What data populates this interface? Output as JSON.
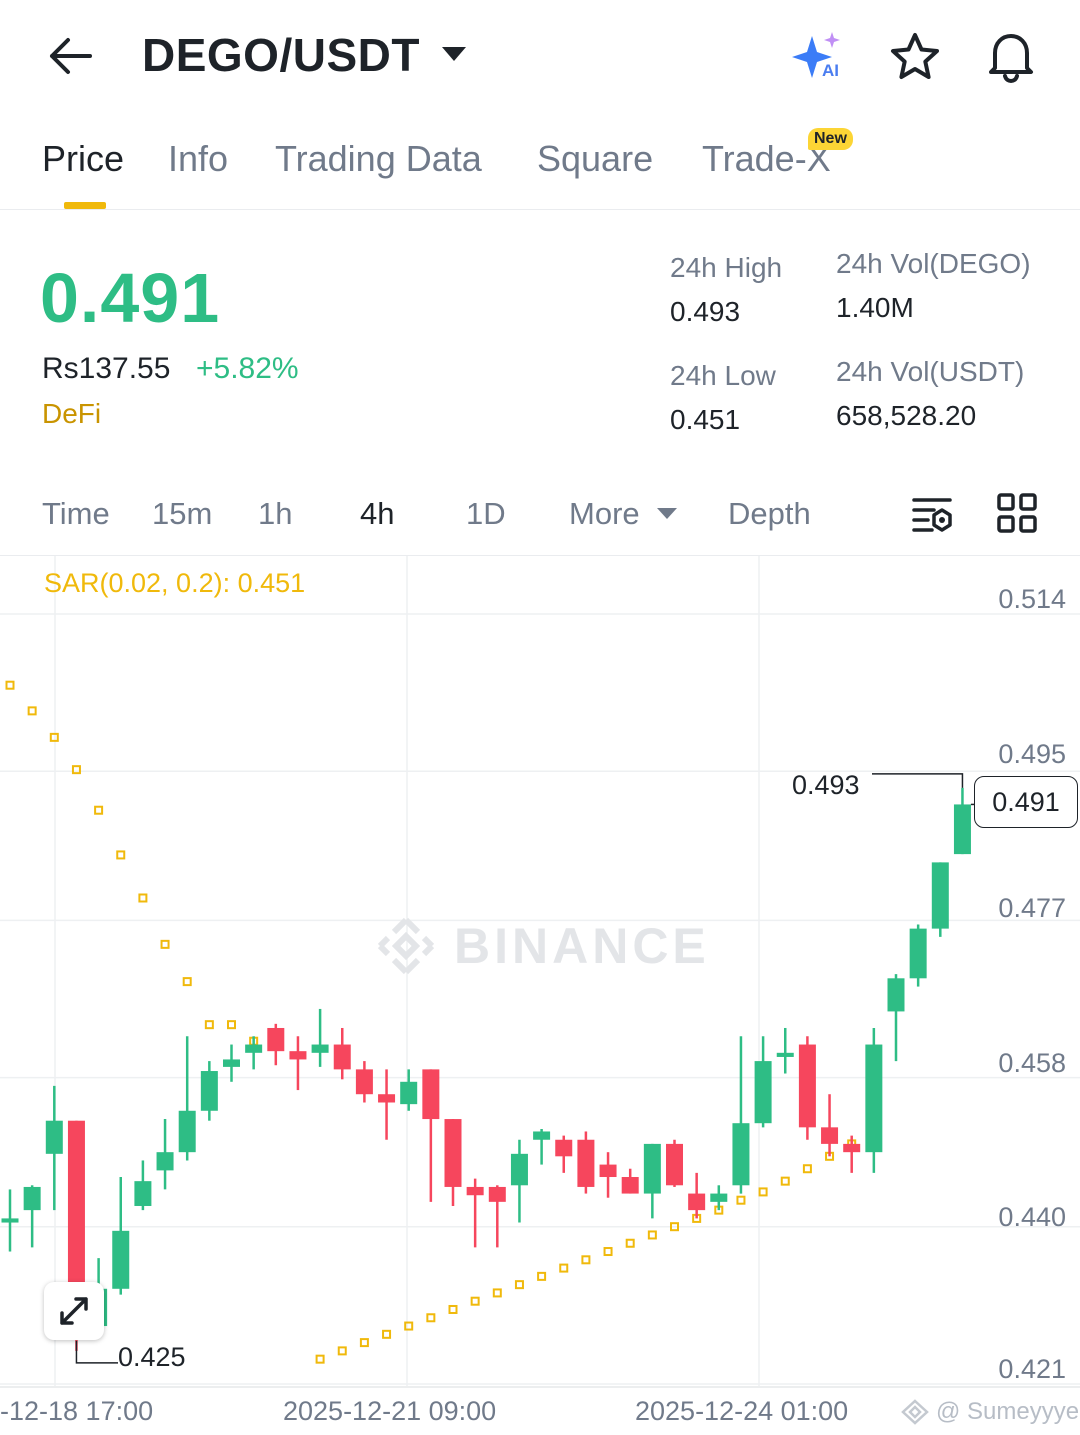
{
  "header": {
    "pair": "DEGO/USDT"
  },
  "tabs": [
    {
      "label": "Price",
      "active": true
    },
    {
      "label": "Info"
    },
    {
      "label": "Trading Data"
    },
    {
      "label": "Square"
    },
    {
      "label": "Trade-X"
    }
  ],
  "tabs_badge": "New",
  "ticker": {
    "last_price": "0.491",
    "fiat_price": "Rs137.55",
    "change": "+5.82%",
    "tag": "DeFi",
    "high_label": "24h High",
    "high_value": "0.493",
    "low_label": "24h Low",
    "low_value": "0.451",
    "vol_base_label": "24h Vol(DEGO)",
    "vol_base_value": "1.40M",
    "vol_quote_label": "24h Vol(USDT)",
    "vol_quote_value": "658,528.20"
  },
  "intervals": [
    "Time",
    "15m",
    "1h",
    "4h",
    "1D",
    "More",
    "Depth"
  ],
  "active_interval": "4h",
  "colors": {
    "up": "#2ebd85",
    "down": "#f6465d",
    "sar": "#f0b90b",
    "accent": "#f0b90b"
  },
  "chart": {
    "indicator_label": "SAR(0.02, 0.2): 0.451",
    "watermark": "BINANCE",
    "y_ticks": [
      "0.514",
      "0.495",
      "0.477",
      "0.458",
      "0.440",
      "0.421"
    ],
    "x_ticks": [
      "-12-18 17:00",
      "2025-12-21 09:00",
      "2025-12-24 01:00"
    ],
    "high_marker": "0.493",
    "low_marker": "0.425",
    "current_price": "0.491",
    "credit": "@ Sumeyyye"
  },
  "chart_data": {
    "type": "candlestick",
    "y_range": [
      0.421,
      0.514
    ],
    "y_tick_values": [
      0.514,
      0.495,
      0.477,
      0.458,
      0.44,
      0.421
    ],
    "candles": [
      {
        "o": 0.4405,
        "h": 0.4445,
        "l": 0.437,
        "c": 0.441
      },
      {
        "o": 0.442,
        "h": 0.445,
        "l": 0.4375,
        "c": 0.4448
      },
      {
        "o": 0.4488,
        "h": 0.457,
        "l": 0.442,
        "c": 0.4528
      },
      {
        "o": 0.4528,
        "h": 0.4528,
        "l": 0.425,
        "c": 0.428
      },
      {
        "o": 0.428,
        "h": 0.4362,
        "l": 0.427,
        "c": 0.4325
      },
      {
        "o": 0.4325,
        "h": 0.446,
        "l": 0.4318,
        "c": 0.4395
      },
      {
        "o": 0.4425,
        "h": 0.448,
        "l": 0.442,
        "c": 0.4455
      },
      {
        "o": 0.4468,
        "h": 0.453,
        "l": 0.4445,
        "c": 0.449
      },
      {
        "o": 0.449,
        "h": 0.463,
        "l": 0.448,
        "c": 0.454
      },
      {
        "o": 0.454,
        "h": 0.46,
        "l": 0.4528,
        "c": 0.4588
      },
      {
        "o": 0.4593,
        "h": 0.462,
        "l": 0.4575,
        "c": 0.4602
      },
      {
        "o": 0.461,
        "h": 0.463,
        "l": 0.459,
        "c": 0.462
      },
      {
        "o": 0.464,
        "h": 0.4645,
        "l": 0.4595,
        "c": 0.4612
      },
      {
        "o": 0.4612,
        "h": 0.463,
        "l": 0.4565,
        "c": 0.4602
      },
      {
        "o": 0.461,
        "h": 0.4663,
        "l": 0.4593,
        "c": 0.462
      },
      {
        "o": 0.462,
        "h": 0.464,
        "l": 0.4578,
        "c": 0.459
      },
      {
        "o": 0.459,
        "h": 0.46,
        "l": 0.455,
        "c": 0.456
      },
      {
        "o": 0.456,
        "h": 0.459,
        "l": 0.4505,
        "c": 0.455
      },
      {
        "o": 0.4548,
        "h": 0.459,
        "l": 0.454,
        "c": 0.4575
      },
      {
        "o": 0.459,
        "h": 0.459,
        "l": 0.443,
        "c": 0.453
      },
      {
        "o": 0.453,
        "h": 0.453,
        "l": 0.4425,
        "c": 0.4448
      },
      {
        "o": 0.4448,
        "h": 0.4458,
        "l": 0.4375,
        "c": 0.4438
      },
      {
        "o": 0.4448,
        "h": 0.445,
        "l": 0.4375,
        "c": 0.443
      },
      {
        "o": 0.445,
        "h": 0.4505,
        "l": 0.4405,
        "c": 0.4488
      },
      {
        "o": 0.4505,
        "h": 0.4518,
        "l": 0.4475,
        "c": 0.4515
      },
      {
        "o": 0.4505,
        "h": 0.451,
        "l": 0.4465,
        "c": 0.4485
      },
      {
        "o": 0.4505,
        "h": 0.4515,
        "l": 0.444,
        "c": 0.4448
      },
      {
        "o": 0.4475,
        "h": 0.449,
        "l": 0.4435,
        "c": 0.446
      },
      {
        "o": 0.446,
        "h": 0.447,
        "l": 0.444,
        "c": 0.444
      },
      {
        "o": 0.444,
        "h": 0.45,
        "l": 0.441,
        "c": 0.45
      },
      {
        "o": 0.45,
        "h": 0.4505,
        "l": 0.4448,
        "c": 0.445
      },
      {
        "o": 0.444,
        "h": 0.4465,
        "l": 0.441,
        "c": 0.442
      },
      {
        "o": 0.443,
        "h": 0.445,
        "l": 0.442,
        "c": 0.444
      },
      {
        "o": 0.445,
        "h": 0.463,
        "l": 0.444,
        "c": 0.4525
      },
      {
        "o": 0.4525,
        "h": 0.463,
        "l": 0.452,
        "c": 0.46
      },
      {
        "o": 0.4605,
        "h": 0.464,
        "l": 0.4585,
        "c": 0.461
      },
      {
        "o": 0.462,
        "h": 0.463,
        "l": 0.4505,
        "c": 0.452
      },
      {
        "o": 0.452,
        "h": 0.456,
        "l": 0.4485,
        "c": 0.45
      },
      {
        "o": 0.45,
        "h": 0.451,
        "l": 0.4465,
        "c": 0.449
      },
      {
        "o": 0.449,
        "h": 0.464,
        "l": 0.4465,
        "c": 0.462
      },
      {
        "o": 0.466,
        "h": 0.4705,
        "l": 0.46,
        "c": 0.47
      },
      {
        "o": 0.47,
        "h": 0.4765,
        "l": 0.469,
        "c": 0.476
      },
      {
        "o": 0.476,
        "h": 0.484,
        "l": 0.475,
        "c": 0.484
      },
      {
        "o": 0.485,
        "h": 0.493,
        "l": 0.485,
        "c": 0.491
      }
    ],
    "sar_upper": [
      0.5054,
      0.5023,
      0.4991,
      0.4952,
      0.4903,
      0.4849,
      0.4797,
      0.4741,
      0.4696,
      0.4644,
      0.4644,
      0.4624
    ],
    "sar_lower": [
      0.424,
      0.425,
      0.426,
      0.427,
      0.428,
      0.429,
      0.43,
      0.431,
      0.432,
      0.433,
      0.434,
      0.435,
      0.436,
      0.437,
      0.438,
      0.439,
      0.44,
      0.441,
      0.442,
      0.4432,
      0.4442,
      0.4455,
      0.447,
      0.4485,
      0.45,
      0.4515
    ]
  }
}
